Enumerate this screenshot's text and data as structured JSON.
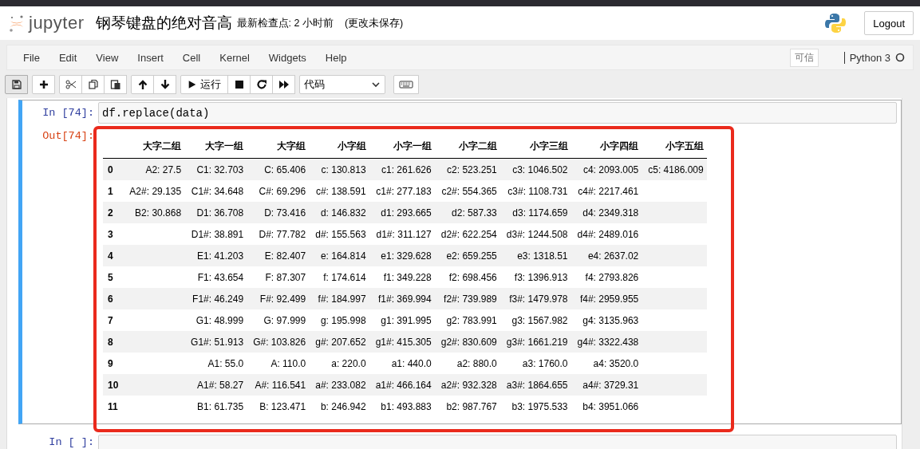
{
  "header": {
    "logo_text": "jupyter",
    "title": "钢琴键盘的绝对音高",
    "checkpoint": "最新检查点: 2 小时前",
    "save_status": "(更改未保存)",
    "logout": "Logout"
  },
  "menu": [
    "File",
    "Edit",
    "View",
    "Insert",
    "Cell",
    "Kernel",
    "Widgets",
    "Help"
  ],
  "kernel": {
    "trusted": "可信",
    "name": "Python 3"
  },
  "toolbar": {
    "run_label": "运行",
    "cell_type": "代码"
  },
  "cells": [
    {
      "prompt": "In [74]:",
      "code": "df.replace(data)",
      "selected": true,
      "output_prompt": "Out[74]:",
      "table": {
        "columns": [
          "大字二组",
          "大字一组",
          "大字组",
          "小字组",
          "小字一组",
          "小字二组",
          "小字三组",
          "小字四组",
          "小字五组"
        ],
        "rows": [
          {
            "index": "0",
            "cells": [
              "A2: 27.5",
              "C1: 32.703",
              "C: 65.406",
              "c: 130.813",
              "c1: 261.626",
              "c2: 523.251",
              "c3: 1046.502",
              "c4: 2093.005",
              "c5: 4186.009"
            ]
          },
          {
            "index": "1",
            "cells": [
              "A2#: 29.135",
              "C1#: 34.648",
              "C#: 69.296",
              "c#: 138.591",
              "c1#: 277.183",
              "c2#: 554.365",
              "c3#: 1108.731",
              "c4#: 2217.461",
              null
            ]
          },
          {
            "index": "2",
            "cells": [
              "B2: 30.868",
              "D1: 36.708",
              "D: 73.416",
              "d: 146.832",
              "d1: 293.665",
              "d2: 587.33",
              "d3: 1174.659",
              "d4: 2349.318",
              null
            ]
          },
          {
            "index": "3",
            "cells": [
              null,
              "D1#: 38.891",
              "D#: 77.782",
              "d#: 155.563",
              "d1#: 311.127",
              "d2#: 622.254",
              "d3#: 1244.508",
              "d4#: 2489.016",
              null
            ]
          },
          {
            "index": "4",
            "cells": [
              null,
              "E1: 41.203",
              "E: 82.407",
              "e: 164.814",
              "e1: 329.628",
              "e2: 659.255",
              "e3: 1318.51",
              "e4: 2637.02",
              null
            ]
          },
          {
            "index": "5",
            "cells": [
              null,
              "F1: 43.654",
              "F: 87.307",
              "f: 174.614",
              "f1: 349.228",
              "f2: 698.456",
              "f3: 1396.913",
              "f4: 2793.826",
              null
            ]
          },
          {
            "index": "6",
            "cells": [
              null,
              "F1#: 46.249",
              "F#: 92.499",
              "f#: 184.997",
              "f1#: 369.994",
              "f2#: 739.989",
              "f3#: 1479.978",
              "f4#: 2959.955",
              null
            ]
          },
          {
            "index": "7",
            "cells": [
              null,
              "G1: 48.999",
              "G: 97.999",
              "g: 195.998",
              "g1: 391.995",
              "g2: 783.991",
              "g3: 1567.982",
              "g4: 3135.963",
              null
            ]
          },
          {
            "index": "8",
            "cells": [
              null,
              "G1#: 51.913",
              "G#: 103.826",
              "g#: 207.652",
              "g1#: 415.305",
              "g2#: 830.609",
              "g3#: 1661.219",
              "g4#: 3322.438",
              null
            ]
          },
          {
            "index": "9",
            "cells": [
              null,
              "A1: 55.0",
              "A: 110.0",
              "a: 220.0",
              "a1: 440.0",
              "a2: 880.0",
              "a3: 1760.0",
              "a4: 3520.0",
              null
            ]
          },
          {
            "index": "10",
            "cells": [
              null,
              "A1#: 58.27",
              "A#: 116.541",
              "a#: 233.082",
              "a1#: 466.164",
              "a2#: 932.328",
              "a3#: 1864.655",
              "a4#: 3729.31",
              null
            ]
          },
          {
            "index": "11",
            "cells": [
              null,
              "B1: 61.735",
              "B: 123.471",
              "b: 246.942",
              "b1: 493.883",
              "b2: 987.767",
              "b3: 1975.533",
              "b4: 3951.066",
              null
            ]
          }
        ]
      }
    },
    {
      "prompt": "In [ ]:",
      "selected": false
    }
  ]
}
